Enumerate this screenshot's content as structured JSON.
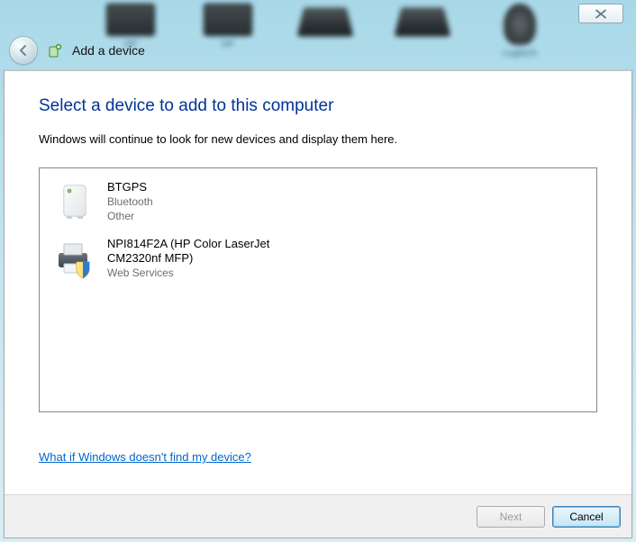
{
  "window": {
    "close_label": "Close"
  },
  "nav": {
    "title": "Add a device"
  },
  "wizard": {
    "heading": "Select a device to add to this computer",
    "subtext": "Windows will continue to look for new devices and display them here.",
    "help_link": "What if Windows doesn't find my device?",
    "devices": [
      {
        "name": "BTGPS",
        "connection": "Bluetooth",
        "category": "Other",
        "icon": "device-generic-icon"
      },
      {
        "name": "NPI814F2A (HP Color LaserJet CM2320nf MFP)",
        "connection": "Web Services",
        "category": "",
        "icon": "printer-shield-icon"
      }
    ]
  },
  "footer": {
    "next_label": "Next",
    "cancel_label": "Cancel"
  }
}
